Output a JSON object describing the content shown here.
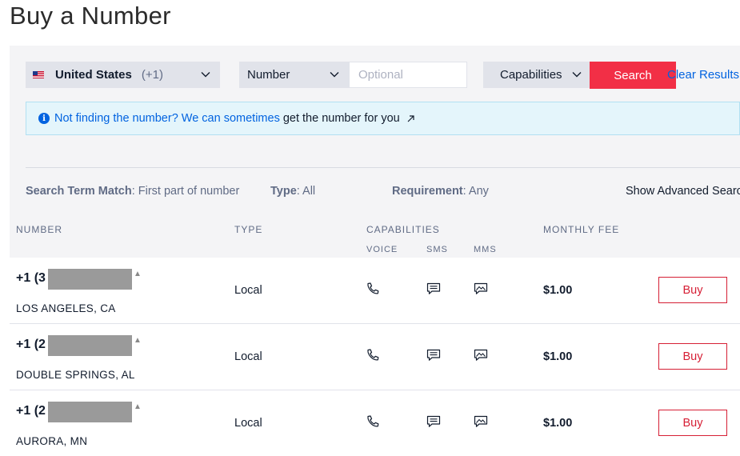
{
  "page": {
    "title": "Buy a Number"
  },
  "search": {
    "country_name": "United States",
    "country_code": "(+1)",
    "number_type": "Number",
    "number_placeholder": "Optional",
    "number_value": "",
    "capabilities_label": "Capabilities",
    "search_label": "Search",
    "clear_label": "Clear Results"
  },
  "banner": {
    "text": "Not finding the number? We can sometimes",
    "link": "get the number for you"
  },
  "filters": {
    "match_label": "Search Term Match",
    "match_value": ": First part of number",
    "type_label": "Type",
    "type_value": ": All",
    "req_label": "Requirement",
    "req_value": ": Any",
    "advanced_label": "Show Advanced Search"
  },
  "table": {
    "headers": {
      "number": "NUMBER",
      "type": "TYPE",
      "capabilities": "CAPABILITIES",
      "voice": "VOICE",
      "sms": "SMS",
      "mms": "MMS",
      "fee": "MONTHLY FEE"
    },
    "rows": [
      {
        "number": "+1 (3",
        "city": "LOS ANGELES, CA",
        "type": "Local",
        "fee": "$1.00",
        "buy": "Buy"
      },
      {
        "number": "+1 (2",
        "city": "DOUBLE SPRINGS, AL",
        "type": "Local",
        "fee": "$1.00",
        "buy": "Buy"
      },
      {
        "number": "+1 (2",
        "city": "AURORA, MN",
        "type": "Local",
        "fee": "$1.00",
        "buy": "Buy"
      }
    ]
  },
  "icons": [
    "flag-us-icon",
    "chevron-down-icon",
    "info-icon",
    "external-link-icon",
    "phone-icon",
    "message-icon",
    "image-icon",
    "sort-caret-icon"
  ],
  "colors": {
    "accent_red": "#f22f46",
    "link_blue": "#0263e0",
    "banner_bg": "#e4f5fb",
    "panel_bg": "#f4f4f6"
  }
}
